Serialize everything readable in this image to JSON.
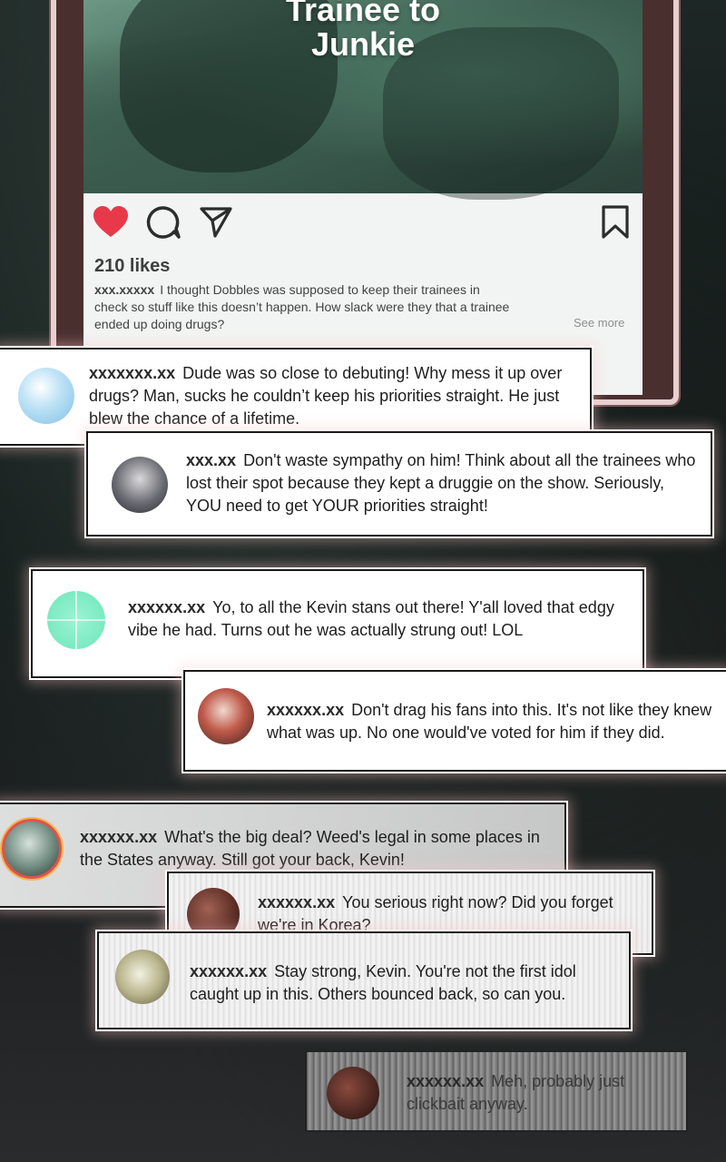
{
  "post": {
    "title_line1": "Trainee to",
    "title_line2": "Junkie",
    "likes": "210 likes",
    "caption_user": "xxx.xxxxx",
    "caption_text": "I thought Dobbles was supposed to keep their trainees in check so stuff like this doesn’t happen. How slack were they that a trainee ended up doing drugs?",
    "see_more": "See more",
    "icons": [
      "heart-icon",
      "comment-icon",
      "share-icon",
      "bookmark-icon"
    ],
    "heart_color": "#e8394a"
  },
  "comments": [
    {
      "user": "xxxxxxx.xx",
      "text": "Dude was so close to debuting! Why mess it up over drugs? Man, sucks he couldn’t keep his priorities straight. He just blew the chance of a lifetime."
    },
    {
      "user": "xxx.xx",
      "text": "Don't waste sympathy on him! Think about all the trainees who lost their spot because they kept a druggie on the show. Seriously, YOU need to get YOUR priorities straight!"
    },
    {
      "user": "xxxxxx.xx",
      "text": "Yo, to all the Kevin stans out there! Y'all loved that edgy vibe he had. Turns out he was actually strung out! LOL"
    },
    {
      "user": "xxxxxx.xx",
      "text": "Don't drag his fans into this. It's not like they knew what was up. No one would've voted for him if they did."
    },
    {
      "user": "xxxxxx.xx",
      "text": "What's the big deal? Weed's legal in some places in the States anyway. Still got your back, Kevin!"
    },
    {
      "user": "xxxxxx.xx",
      "text": "You serious right now? Did you forget we're in Korea?"
    },
    {
      "user": "xxxxxx.xx",
      "text": "Stay strong, Kevin. You're not the first idol caught up in this. Others bounced back, so can you."
    },
    {
      "user": "xxxxxx.xx",
      "text": "Meh, probably just clickbait anyway."
    }
  ]
}
